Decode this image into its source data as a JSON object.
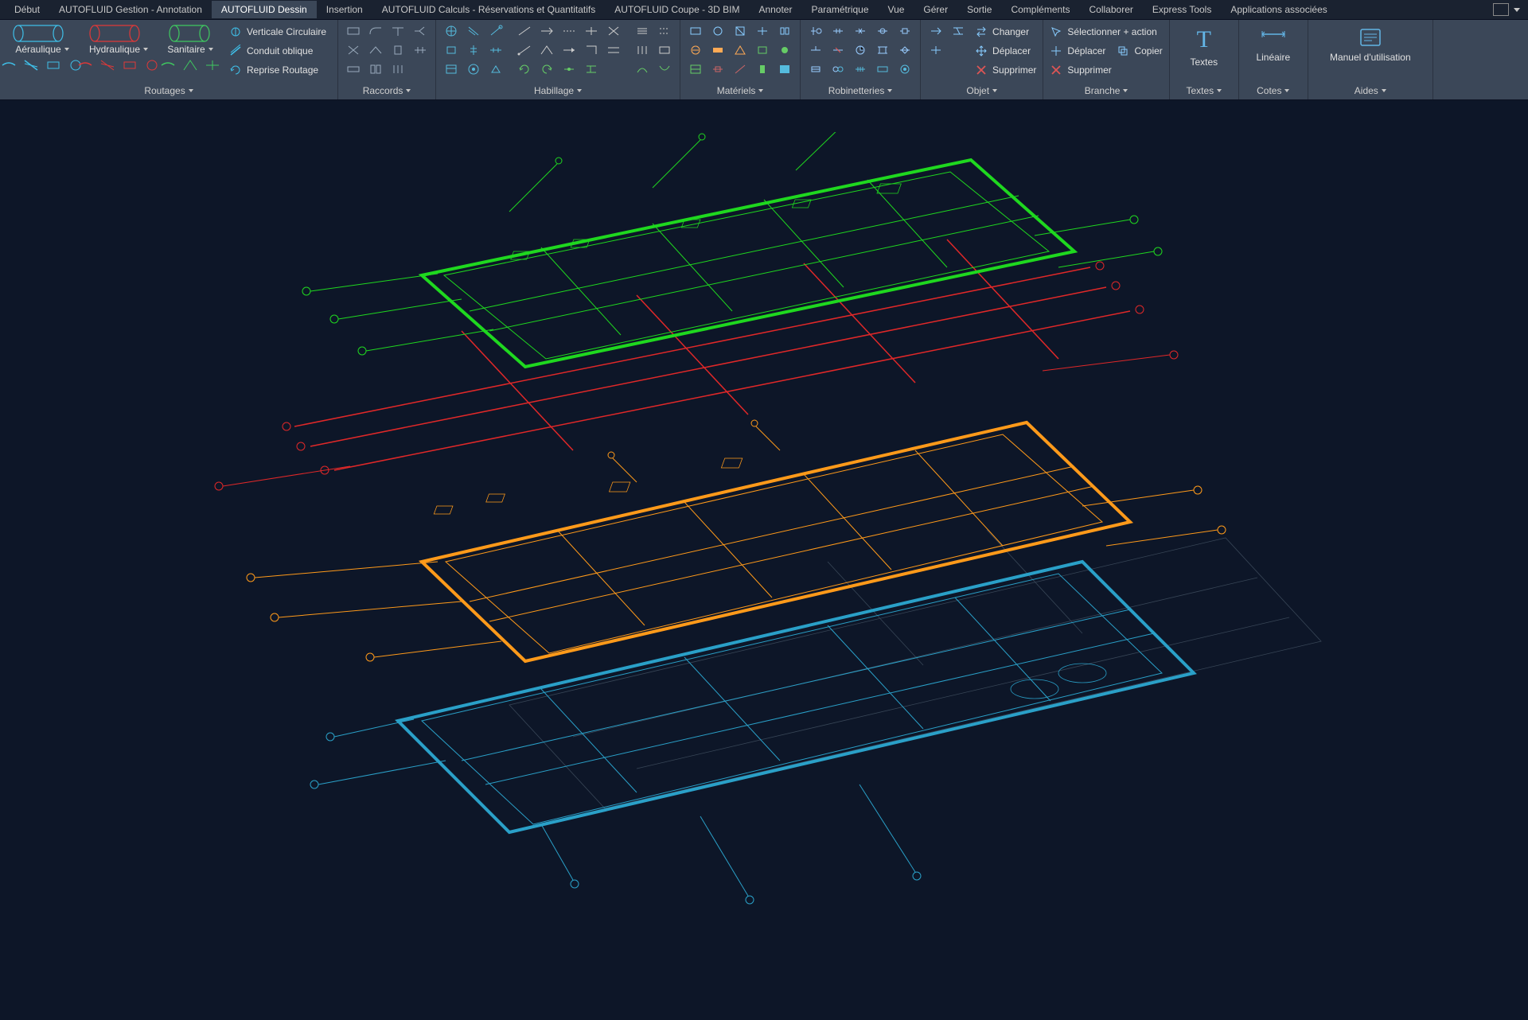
{
  "tabs": [
    "Début",
    "AUTOFLUID Gestion - Annotation",
    "AUTOFLUID Dessin",
    "Insertion",
    "AUTOFLUID Calculs - Réservations et Quantitatifs",
    "AUTOFLUID Coupe - 3D BIM",
    "Annoter",
    "Paramétrique",
    "Vue",
    "Gérer",
    "Sortie",
    "Compléments",
    "Collaborer",
    "Express Tools",
    "Applications associées"
  ],
  "active_tab_index": 2,
  "ribbon": {
    "routages": {
      "title": "Routages",
      "aer": "Aéraulique",
      "hyd": "Hydraulique",
      "san": "Sanitaire",
      "vert_circ": "Verticale Circulaire",
      "conduit": "Conduit oblique",
      "reprise": "Reprise Routage"
    },
    "raccords": {
      "title": "Raccords"
    },
    "habillage": {
      "title": "Habillage"
    },
    "materiels": {
      "title": "Matériels"
    },
    "robinet": {
      "title": "Robinetteries"
    },
    "objet": {
      "title": "Objet",
      "changer": "Changer",
      "deplacer": "Déplacer",
      "supprimer": "Supprimer"
    },
    "branche": {
      "title": "Branche",
      "select_action": "Sélectionner + action",
      "deplacer": "Déplacer",
      "copier": "Copier",
      "supprimer": "Supprimer"
    },
    "textes_panel": {
      "title": "Textes",
      "big": "Textes"
    },
    "cotes": {
      "title": "Cotes",
      "big": "Linéaire"
    },
    "aides": {
      "title": "Aides",
      "big": "Manuel d'utilisation"
    }
  },
  "colors": {
    "aer": "#3fbfe8",
    "hyd": "#e03838",
    "san": "#3fc860",
    "layer_green": "#1fd81f",
    "layer_red": "#e02828",
    "layer_orange": "#ff9a1a",
    "layer_teal": "#2aa0c8",
    "layer_faint": "#4a5a6a"
  }
}
